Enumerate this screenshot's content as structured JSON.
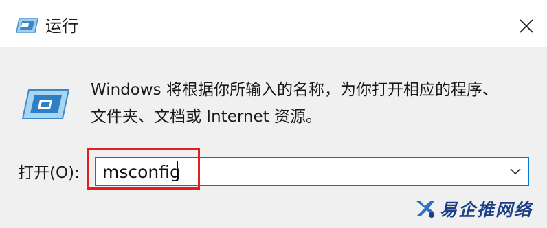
{
  "window": {
    "title": "运行",
    "close_glyph": "✕"
  },
  "description": {
    "line1": "Windows 将根据你所输入的名称，为你打开相应的程序、",
    "line2": "文件夹、文档或 Internet 资源。"
  },
  "open_field": {
    "label": "打开(O):",
    "value": "msconfig",
    "dropdown_glyph": "chevron-down-icon"
  },
  "watermark": {
    "text": "易企推网络"
  },
  "colors": {
    "accent": "#0078d7",
    "highlight": "#e02020",
    "dialog_bg": "#f0f0f0",
    "watermark": "#1d3f87"
  }
}
